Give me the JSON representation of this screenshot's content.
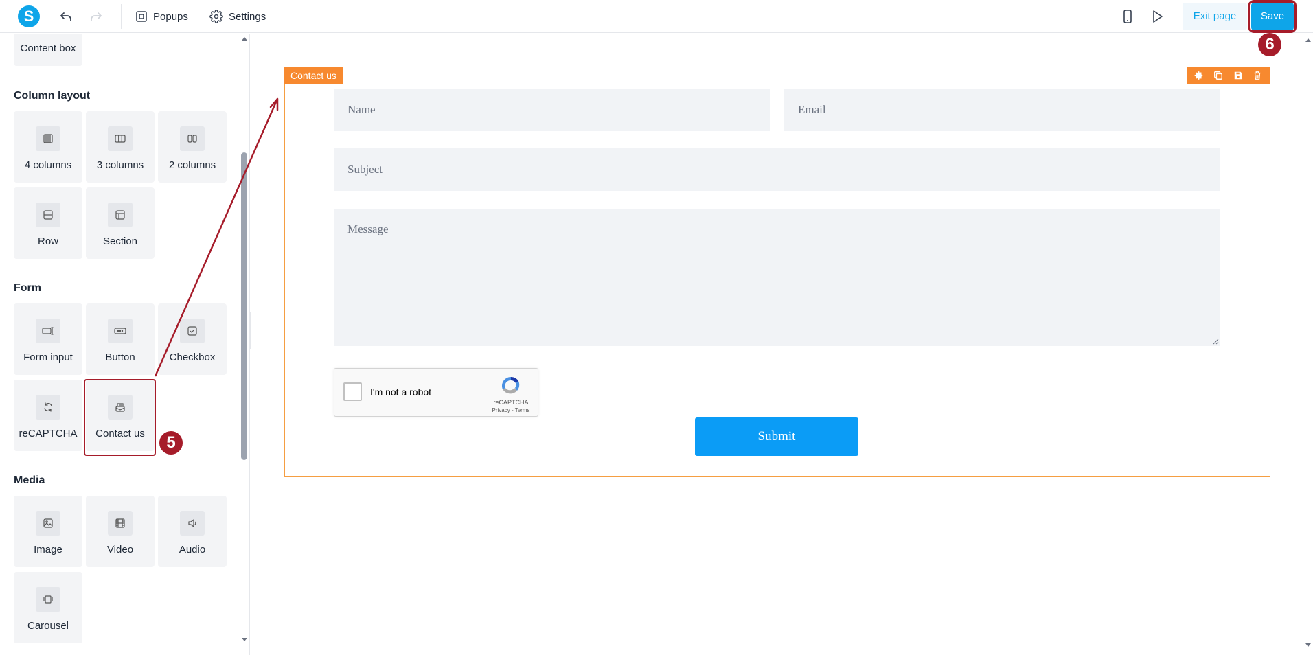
{
  "topbar": {
    "logo_letter": "S",
    "popups_label": "Popups",
    "settings_label": "Settings",
    "exit_label": "Exit page",
    "save_label": "Save"
  },
  "sidebar": {
    "top_item": "Content box",
    "column_layout": {
      "title": "Column layout",
      "items": [
        "4 columns",
        "3 columns",
        "2 columns",
        "Row",
        "Section"
      ]
    },
    "form": {
      "title": "Form",
      "items": [
        "Form input",
        "Button",
        "Checkbox",
        "reCAPTCHA",
        "Contact us"
      ]
    },
    "media": {
      "title": "Media",
      "items": [
        "Image",
        "Video",
        "Audio",
        "Carousel"
      ]
    }
  },
  "canvas": {
    "block_label": "Contact us",
    "fields": {
      "name_placeholder": "Name",
      "email_placeholder": "Email",
      "subject_placeholder": "Subject",
      "message_placeholder": "Message"
    },
    "recaptcha": {
      "label": "I'm not a robot",
      "brand": "reCAPTCHA",
      "links": "Privacy - Terms"
    },
    "submit_label": "Submit"
  },
  "annotations": {
    "step5": "5",
    "step6": "6",
    "color": "#a61c2a"
  }
}
